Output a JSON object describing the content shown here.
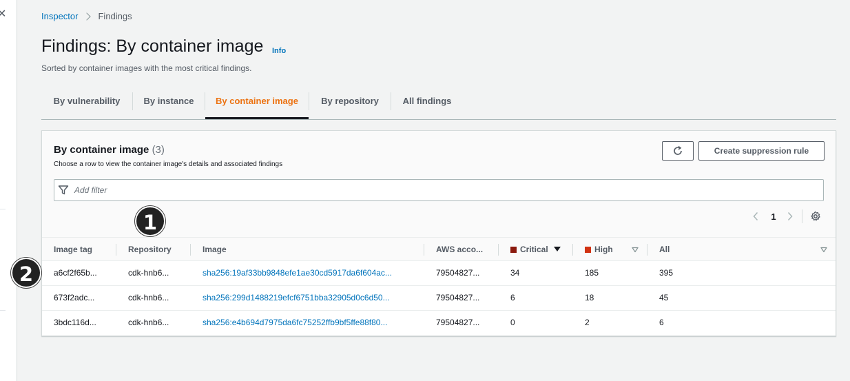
{
  "breadcrumb": {
    "parent": "Inspector",
    "current": "Findings"
  },
  "page": {
    "title": "Findings: By container image",
    "info": "Info",
    "description": "Sorted by container images with the most critical findings."
  },
  "tabs": [
    {
      "label": "By vulnerability",
      "active": false
    },
    {
      "label": "By instance",
      "active": false
    },
    {
      "label": "By container image",
      "active": true
    },
    {
      "label": "By repository",
      "active": false
    },
    {
      "label": "All findings",
      "active": false
    }
  ],
  "panel": {
    "title": "By container image",
    "count": "(3)",
    "description": "Choose a row to view the container image's details and associated findings",
    "suppression_button": "Create suppression rule",
    "refresh_icon": "refresh-icon",
    "filter_placeholder": "Add filter",
    "page_number": "1"
  },
  "columns": {
    "image_tag": "Image tag",
    "repository": "Repository",
    "image": "Image",
    "aws_account": "AWS acco...",
    "critical": "Critical",
    "high": "High",
    "all": "All"
  },
  "colors": {
    "critical": "#8b1a0e",
    "high": "#d13212",
    "link": "#0073bb",
    "active_tab": "#ec7211"
  },
  "rows": [
    {
      "image_tag": "a6cf2f65b...",
      "repository": "cdk-hnb6...",
      "image": "sha256:19af33bb9848efe1ae30cd5917da6f604ac...",
      "aws_account": "79504827...",
      "critical": "34",
      "high": "185",
      "all": "395"
    },
    {
      "image_tag": "673f2adc...",
      "repository": "cdk-hnb6...",
      "image": "sha256:299d1488219efcf6751bba32905d0c6d50...",
      "aws_account": "79504827...",
      "critical": "6",
      "high": "18",
      "all": "45"
    },
    {
      "image_tag": "3bdc116d...",
      "repository": "cdk-hnb6...",
      "image": "sha256:e4b694d7975da6fc75252ffb9bf5ffe88f80...",
      "aws_account": "79504827...",
      "critical": "0",
      "high": "2",
      "all": "6"
    }
  ],
  "callouts": [
    "1",
    "2"
  ]
}
